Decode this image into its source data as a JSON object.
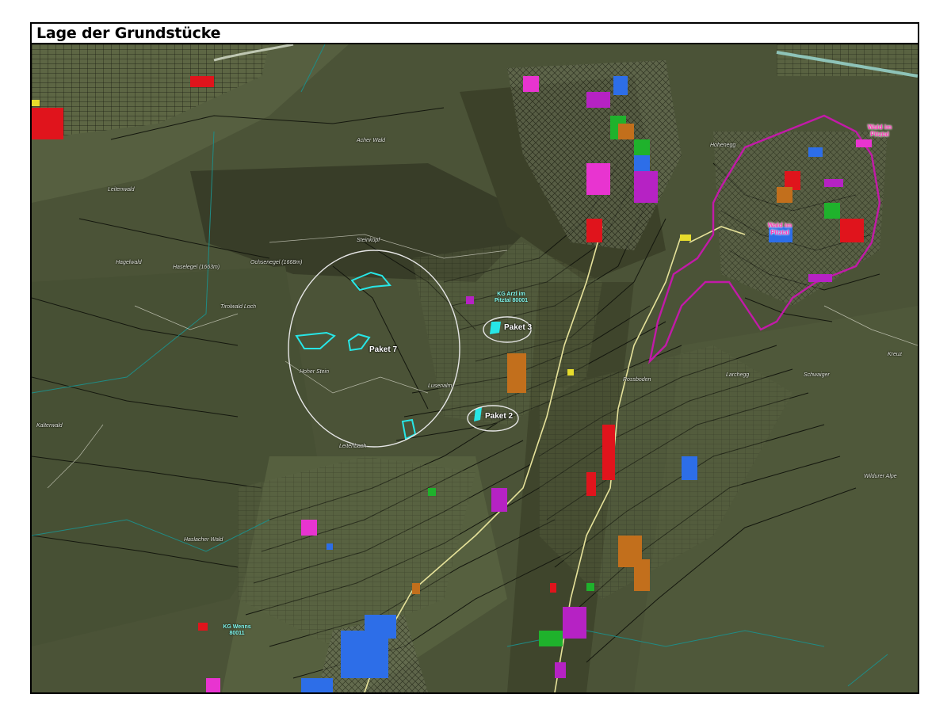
{
  "title": "Lage der Grundstücke",
  "colors": {
    "parcel_highlight": "#27e6e6",
    "boundary": "#c21aa8",
    "circle": "#e6e6e6",
    "road": "#e6e29a"
  },
  "map": {
    "place_labels": {
      "acher_wald": "Acher Wald",
      "leitenwald": "Leitenwald",
      "hagelwald": "Hagelwald",
      "steinkopf": "Steinkopf",
      "haselegel": "Haselegel (1663m)",
      "ochsenegel": "Ochsenegel (1668m)",
      "tiroler_loch": "Tirolwald Loch",
      "hoher_stein": "Hoher Stein",
      "lusenalm": "Lusenalm",
      "kalterwald": "Kalterwald",
      "leitenbach": "Leitenbach",
      "haslacher_wald": "Haslacher Wald",
      "larchegg": "Larchegg",
      "schwaiger": "Schwaiger",
      "wildurer_alpe": "Wildurer Alpe",
      "rossboden": "Rossboden",
      "kreuz": "Kreuz",
      "hohenegg": "Hohenegg"
    },
    "kg_labels": {
      "arzl": "KG Arzl im Pitztal 80001",
      "wenns": "KG Wenns 80011"
    },
    "wald_labels": {
      "wald1": "Wald im Pitztal",
      "wald2": "Wald im Pitztal"
    },
    "pakete": {
      "paket3": "Paket 3",
      "paket7": "Paket 7",
      "paket2": "Paket 2"
    }
  }
}
